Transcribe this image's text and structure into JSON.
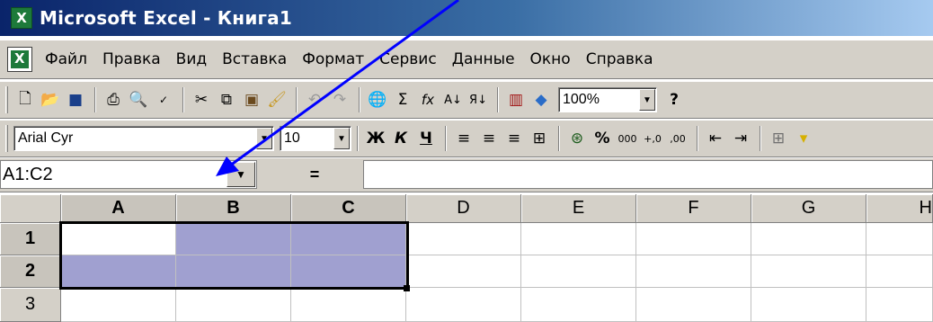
{
  "window": {
    "title": "Microsoft Excel - Книга1"
  },
  "menu": {
    "items": [
      "Файл",
      "Правка",
      "Вид",
      "Вставка",
      "Формат",
      "Сервис",
      "Данные",
      "Окно",
      "Справка"
    ]
  },
  "standard_toolbar": {
    "zoom": "100%",
    "icons": [
      "new-icon",
      "open-icon",
      "save-icon",
      "print-icon",
      "print-preview-icon",
      "spelling-icon",
      "cut-icon",
      "copy-icon",
      "paste-icon",
      "format-painter-icon",
      "undo-icon",
      "redo-icon",
      "web-icon",
      "autosum-icon",
      "function-icon",
      "sort-ascending-icon",
      "sort-descending-icon",
      "chart-wizard-icon",
      "drawing-icon"
    ],
    "help_glyph": "?"
  },
  "format_toolbar": {
    "font": "Arial Cyr",
    "size": "10",
    "bold": "Ж",
    "italic": "К",
    "underline": "Ч",
    "percent": "%",
    "thousands": "000",
    "inc_decimal": "+,0",
    "dec_decimal": ",00"
  },
  "formula_bar": {
    "name_box": "A1:C2",
    "equals": "=",
    "formula": ""
  },
  "sheet": {
    "columns": [
      "A",
      "B",
      "C",
      "D",
      "E",
      "F",
      "G",
      "H"
    ],
    "rows": [
      "1",
      "2",
      "3"
    ],
    "selection": "A1:C2",
    "active_cell": "A1",
    "selection_color": "#a0a0d0"
  },
  "annotation": {
    "arrow_color": "#0000ff"
  }
}
